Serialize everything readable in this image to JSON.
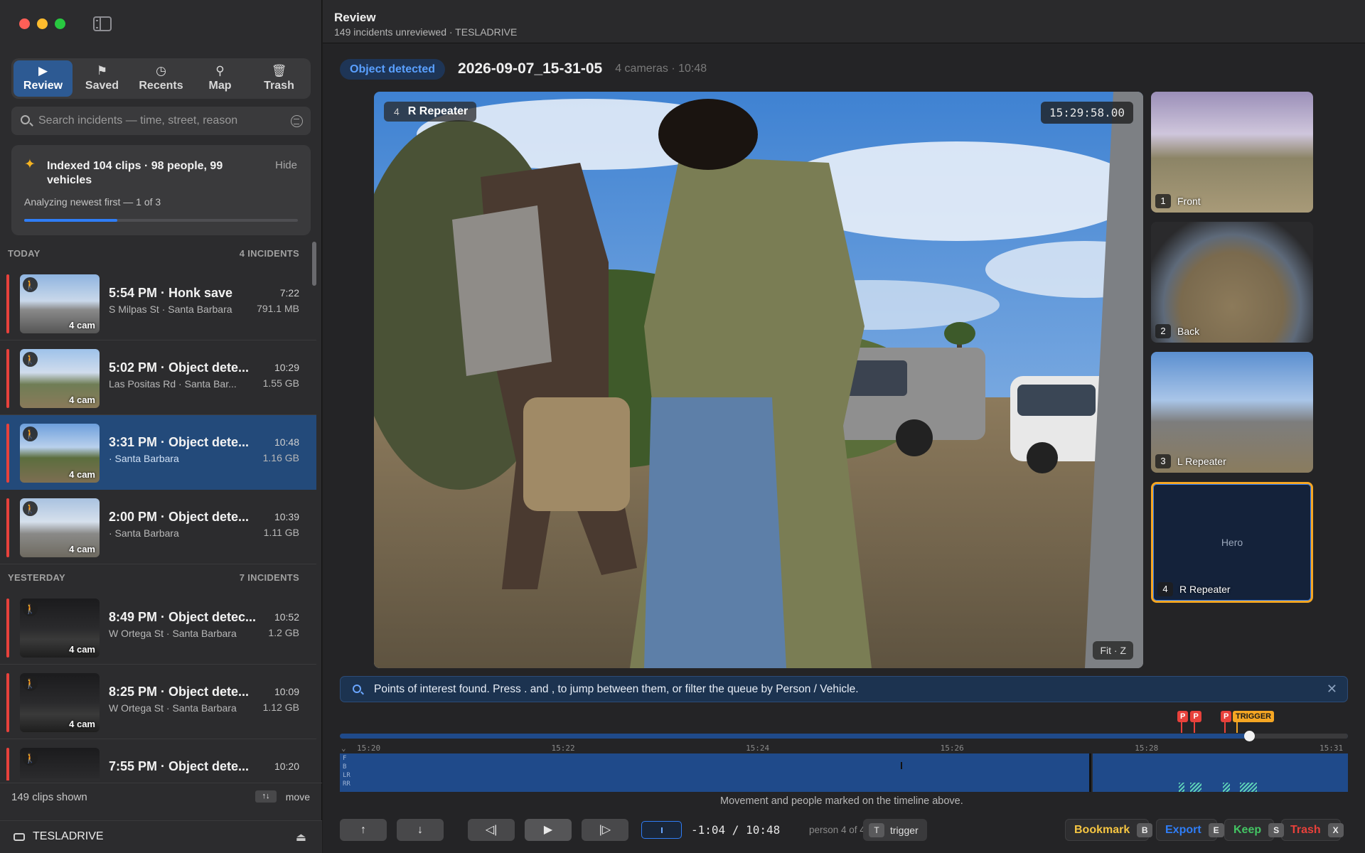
{
  "sidebar": {
    "nav": [
      {
        "label": "Review",
        "icon": "play-icon",
        "glyph": "▶"
      },
      {
        "label": "Saved",
        "icon": "flag-icon",
        "glyph": "⚑"
      },
      {
        "label": "Recents",
        "icon": "clock-icon",
        "glyph": "◷"
      },
      {
        "label": "Map",
        "icon": "map-pin-icon",
        "glyph": "⚲"
      },
      {
        "label": "Trash",
        "icon": "trash-icon",
        "glyph": "🗑"
      }
    ],
    "search_placeholder": "Search incidents — time, street, reason",
    "index": {
      "title": "Indexed 104 clips · 98 people, 99 vehicles",
      "hide": "Hide",
      "status": "Analyzing newest first — 1 of 3",
      "progress": 0.34
    },
    "sections": [
      {
        "label": "TODAY",
        "count": "4 INCIDENTS",
        "rows": [
          {
            "title": "5:54 PM · Honk save",
            "loc": "S Milpas St · Santa Barbara",
            "dur": "7:22",
            "size": "791.1 MB",
            "cams": "4 cam",
            "selected": false,
            "theme": "day1"
          },
          {
            "title": "5:02 PM · Object dete...",
            "loc": "Las Positas Rd · Santa Bar...",
            "dur": "10:29",
            "size": "1.55 GB",
            "cams": "4 cam",
            "selected": false,
            "theme": "day2"
          },
          {
            "title": "3:31 PM · Object dete...",
            "loc": " · Santa Barbara",
            "dur": "10:48",
            "size": "1.16 GB",
            "cams": "4 cam",
            "selected": true,
            "theme": "day3"
          },
          {
            "title": "2:00 PM · Object dete...",
            "loc": " · Santa Barbara",
            "dur": "10:39",
            "size": "1.11 GB",
            "cams": "4 cam",
            "selected": false,
            "theme": "day4"
          }
        ]
      },
      {
        "label": "YESTERDAY",
        "count": "7 INCIDENTS",
        "rows": [
          {
            "title": "8:49 PM · Object detec...",
            "loc": "W Ortega St · Santa Barbara",
            "dur": "10:52",
            "size": "1.2 GB",
            "cams": "4 cam",
            "selected": false,
            "theme": "night"
          },
          {
            "title": "8:25 PM · Object dete...",
            "loc": "W Ortega St · Santa Barbara",
            "dur": "10:09",
            "size": "1.12 GB",
            "cams": "4 cam",
            "selected": false,
            "theme": "night"
          },
          {
            "title": "7:55 PM · Object dete...",
            "loc": "",
            "dur": "10:20",
            "size": "",
            "cams": "4 cam",
            "selected": false,
            "theme": "night"
          }
        ]
      }
    ],
    "footer": {
      "count": "149 clips shown",
      "keys": "↑↓",
      "move": "move"
    },
    "drive": {
      "name": "TESLADRIVE",
      "eject": "⏏"
    }
  },
  "topbar": {
    "title": "Review",
    "subtitle": "149 incidents unreviewed · TESLADRIVE"
  },
  "clip": {
    "badge": "Object detected",
    "name": "2026-09-07_15-31-05",
    "meta": "4 cameras · 10:48"
  },
  "hero": {
    "num": "4",
    "camera": "R Repeater",
    "timestamp": "15:29:58.00",
    "fit": "Fit · Z"
  },
  "cameras": [
    {
      "num": "1",
      "label": "Front",
      "hero": false
    },
    {
      "num": "2",
      "label": "Back",
      "hero": false
    },
    {
      "num": "3",
      "label": "L Repeater",
      "hero": false
    },
    {
      "num": "4",
      "label": "R Repeater",
      "hero": true,
      "placeholder": "Hero"
    }
  ],
  "poi": {
    "text": "Points of interest found. Press  .  and  ,  to jump between them, or filter the queue by Person / Vehicle.",
    "close": "✕"
  },
  "timeline": {
    "ticks": [
      "15:20",
      "15:22",
      "15:24",
      "15:26",
      "15:28",
      "15:31"
    ],
    "lanes": [
      "F",
      "B",
      "LR",
      "RR"
    ],
    "markers": [
      {
        "label": "P",
        "type": "p",
        "t": 0.835
      },
      {
        "label": "P",
        "type": "p",
        "t": 0.848
      },
      {
        "label": "P",
        "type": "p",
        "t": 0.878
      },
      {
        "label": "TRIGGER",
        "type": "t",
        "t": 0.89
      }
    ],
    "playhead": 0.902,
    "note": "Movement and people marked on the timeline above."
  },
  "controls": {
    "up": "↑",
    "down": "↓",
    "prev": "◁|",
    "play": "▶",
    "next": "|▷",
    "time": "-1:04 / 10:48",
    "person": "person 4 of 4",
    "trigger_key": "T",
    "trigger_label": "trigger",
    "actions": [
      {
        "label": "Bookmark",
        "key": "B",
        "color": "#f5c542"
      },
      {
        "label": "Export",
        "key": "E",
        "color": "#2f7df6"
      },
      {
        "label": "Keep",
        "key": "S",
        "color": "#43c463"
      },
      {
        "label": "Trash",
        "key": "X",
        "color": "#e8413b"
      }
    ]
  },
  "colors": {
    "accent": "#2f7df6",
    "incident": "#e8413b",
    "trigger": "#f5a623",
    "selected_row": "#234a7a"
  }
}
